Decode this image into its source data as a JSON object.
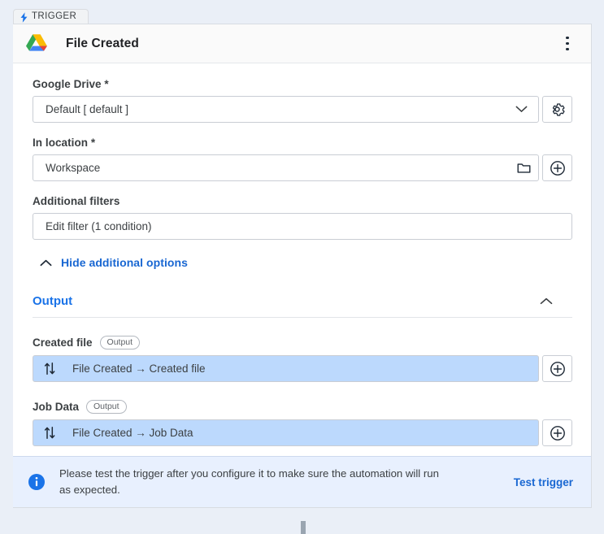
{
  "tab": {
    "label": "TRIGGER",
    "icon": "lightning-bolt-icon",
    "icon_color": "#1a73e8"
  },
  "card": {
    "accent_color": "#d93025",
    "header": {
      "app_icon": "google-drive-icon",
      "title": "File Created",
      "menu_icon": "more-vertical-icon"
    }
  },
  "fields": [
    {
      "label": "Google Drive *",
      "value": "Default [ default ]",
      "dropdown_icon": "chevron-down-icon",
      "side_button_icon": "gear-icon"
    },
    {
      "label": "In location *",
      "value": "Workspace",
      "inline_icon": "folder-icon",
      "side_button_icon": "plus-circle-icon"
    },
    {
      "label": "Additional filters",
      "value": "Edit filter (1 condition)"
    }
  ],
  "hide_options": {
    "label": "Hide additional options",
    "icon": "chevron-up-icon",
    "color": "#1967d2"
  },
  "output_section": {
    "title": "Output",
    "collapse_icon": "chevron-up-icon",
    "title_color": "#1a73e8",
    "items": [
      {
        "label": "Created file",
        "badge": "Output",
        "value": "File Created → Created file",
        "value_icon": "variable-arrows-icon",
        "add_icon": "plus-circle-icon",
        "field_color": "#bcd9fd"
      },
      {
        "label": "Job Data",
        "badge": "Output",
        "value": "File Created → Job Data",
        "value_icon": "variable-arrows-icon",
        "add_icon": "plus-circle-icon",
        "field_color": "#bcd9fd"
      }
    ]
  },
  "info_banner": {
    "icon": "info-circle-icon",
    "text": "Please test the trigger after you configure it to make sure the automation will run as expected.",
    "action_label": "Test trigger",
    "action_color": "#1967d2",
    "background": "#e8f0fe"
  }
}
